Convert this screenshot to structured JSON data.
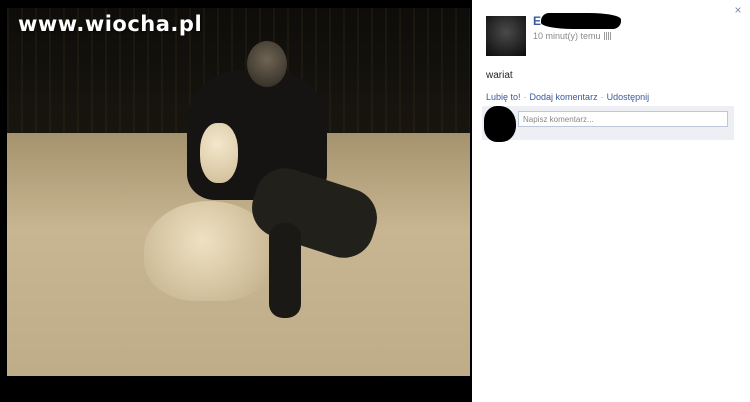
{
  "watermark": {
    "text": "www.wiocha.pl"
  },
  "photo": {
    "description_icon": "photo-of-person-with-snowman"
  },
  "panel": {
    "close_label": "×",
    "author": {
      "name": "E"
    },
    "timestamp": "10 minut(y) temu",
    "caption": "wariat",
    "actions": {
      "like": "Lubię to!",
      "comment": "Dodaj komentarz",
      "share": "Udostępnij",
      "separator": "·"
    },
    "comment": {
      "placeholder": "Napisz komentarz..."
    }
  },
  "colors": {
    "link": "#3b5998",
    "panel_bg": "#ffffff",
    "comment_bg": "#edeff4"
  }
}
